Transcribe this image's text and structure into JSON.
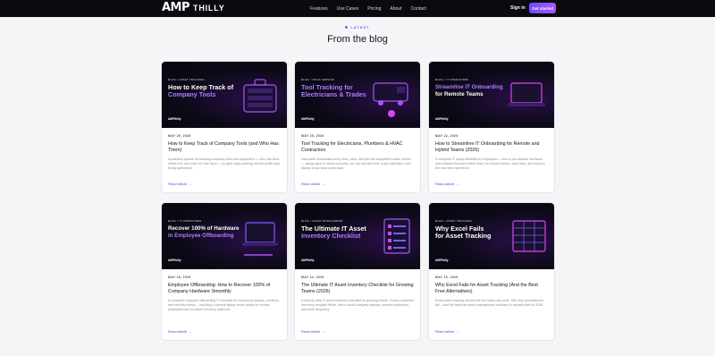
{
  "nav": {
    "logo_mark": "AMP",
    "logo_word": "THILLY",
    "links": [
      "Features",
      "Use Cases",
      "Pricing",
      "About",
      "Contact"
    ],
    "signin": "Sign in",
    "cta": "Get started"
  },
  "section": {
    "kicker": "LATEST",
    "title": "From the blog"
  },
  "posts": [
    {
      "eyebrow": "BLOG / ASSET TRACKING",
      "thumb_lines": [
        "How to Keep Track of",
        "Company Tools"
      ],
      "brand": "AMPthilly",
      "date": "MAY 29, 2026",
      "title": "How to Keep Track of Company Tools (and Who Has Them)",
      "excerpt": "A practical system for tracking company tools and equipment — who has what, where it is, and when it's due back — so gear stops walking off and audits stop being guesswork.",
      "read": "Read article →"
    },
    {
      "eyebrow": "BLOG / FIELD SERVICE",
      "thumb_lines": [
        "Tool Tracking for",
        "Electricians & Trades"
      ],
      "brand": "AMPthilly",
      "date": "MAY 29, 2026",
      "title": "Tool Tracking for Electricians, Plumbers & HVAC Contractors",
      "excerpt": "How trade businesses keep tools, vans, and job-site equipment under control — assign gear to crews and jobs, cut van and site theft, track calibration, and always know what came back.",
      "read": "Read article →"
    },
    {
      "eyebrow": "BLOG / IT OPERATIONS",
      "thumb_lines": [
        "Streamline IT Onboarding",
        "for Remote Teams"
      ],
      "brand": "AMPthilly",
      "date": "MAY 22, 2026",
      "title": "How to Streamline IT Onboarding for Remote and Hybrid Teams (2026)",
      "excerpt": "A complete IT setup checklist for employees – how to pre-allocate hardware and software licenses before Day 1 to reduce friction, save time, and improve the new hire experience.",
      "read": "Read article →"
    },
    {
      "eyebrow": "BLOG / IT OPERATIONS",
      "thumb_lines": [
        "Recover 100% of Hardware",
        "in Employee Offboarding"
      ],
      "brand": "AMPthilly",
      "date": "MAY 18, 2026",
      "title": "Employee Offboarding: How to Recover 100% of Company Hardware Smoothly",
      "excerpt": "A complete employee offboarding IT checklist for recovering laptops, monitors, and security tokens – including a sample laptop return policy for remote employees and an asset recovery playbook.",
      "read": "Read article →"
    },
    {
      "eyebrow": "BLOG / ASSET MANAGEMENT",
      "thumb_lines": [
        "The Ultimate IT Asset",
        "Inventory Checklist"
      ],
      "brand": "AMPthilly",
      "date": "MAY 14, 2026",
      "title": "The Ultimate IT Asset Inventory Checklist for Growing Teams (2026)",
      "excerpt": "A step-by-step IT asset inventory checklist for growing teams. Covers hardware inventory template fields, how to audit company laptops, remote employees, and audit frequency.",
      "read": "Read article →"
    },
    {
      "eyebrow": "BLOG / ASSET TRACKING",
      "thumb_lines": [
        "Why Excel Fails",
        "for Asset Tracking"
      ],
      "brand": "AMPthilly",
      "date": "MAY 10, 2026",
      "title": "Why Excel Fails for Asset Tracking (And the Best Free Alternatives)",
      "excerpt": "Excel asset tracking seems free but hides real costs. See why spreadsheets fail – and the best free asset management software to replace them in 2026.",
      "read": "Read article →"
    }
  ]
}
